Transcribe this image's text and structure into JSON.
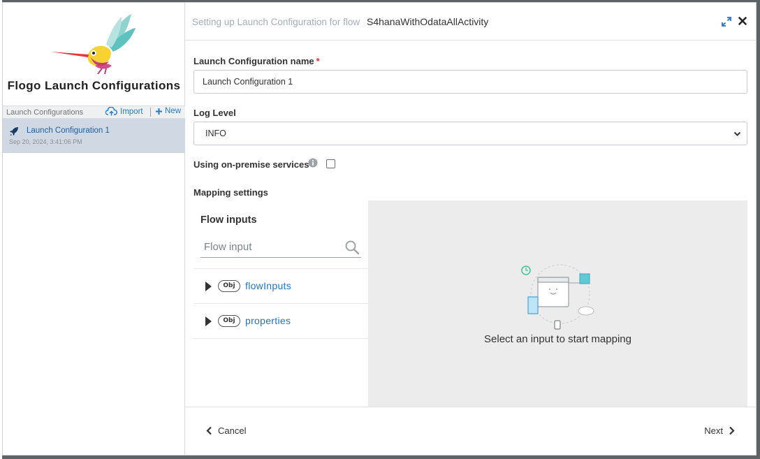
{
  "sidebar": {
    "title": "Flogo Launch Configurations",
    "list_header": "Launch Configurations",
    "import_label": "Import",
    "new_label": "New",
    "items": [
      {
        "name": "Launch Configuration 1",
        "date": "Sep 20, 2024, 3:41:06 PM"
      }
    ]
  },
  "header": {
    "prefix": "Setting up Launch Configuration for flow",
    "flow_name": "S4hanaWithOdataAllActivity"
  },
  "form": {
    "name_label": "Launch Configuration name",
    "name_required_mark": "*",
    "name_value": "Launch Configuration 1",
    "log_level_label": "Log Level",
    "log_level_value": "INFO",
    "onprem_label": "Using on-premise services",
    "onprem_checked": false,
    "mapping_label": "Mapping settings"
  },
  "flow_inputs": {
    "title": "Flow inputs",
    "search_placeholder": "Flow input",
    "items": [
      {
        "badge": "Obj",
        "name": "flowInputs"
      },
      {
        "badge": "Obj",
        "name": "properties"
      }
    ]
  },
  "mapping": {
    "empty_message": "Select an input to start mapping"
  },
  "footer": {
    "cancel_label": "Cancel",
    "next_label": "Next"
  },
  "colors": {
    "accent": "#1f7bd1",
    "selected_row": "#cfd8e3",
    "required": "#d92d2d",
    "mapping_bg": "#ececec"
  }
}
